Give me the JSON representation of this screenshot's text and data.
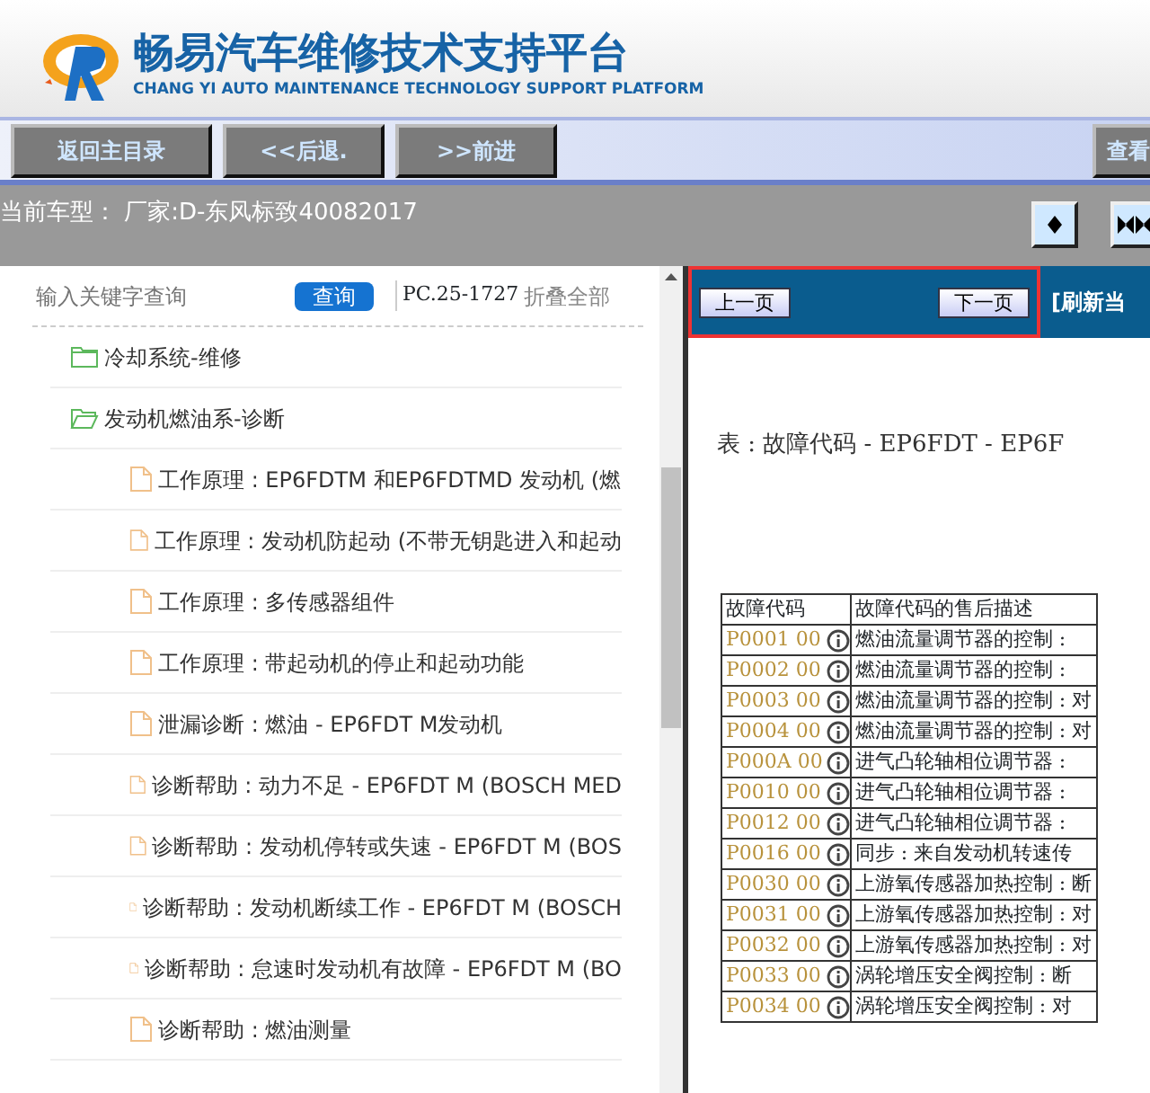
{
  "header": {
    "title": "畅易汽车维修技术支持平台",
    "subtitle": "CHANG YI AUTO MAINTENANCE TECHNOLOGY SUPPORT PLATFORM"
  },
  "toolbar": {
    "buttons": [
      "返回主目录",
      "<<后退.",
      ">>前进"
    ],
    "right_button": "查看"
  },
  "vehicle_bar": {
    "text": "当前车型：  厂家:D-东风标致40082017"
  },
  "sidebar": {
    "search": {
      "placeholder": "输入关键字查询"
    },
    "search_button": "查询",
    "code": "PC.25-1727",
    "collapse_all": "折叠全部",
    "tree": [
      {
        "label": "冷却系统-维修",
        "expanded": false
      },
      {
        "label": "发动机燃油系-诊断",
        "expanded": true,
        "children": [
          {
            "label": "工作原理 : EP6FDTM 和EP6FDTMD 发动机 (燃"
          },
          {
            "label": "工作原理 : 发动机防起动 (不带无钥匙进入和起动"
          },
          {
            "label": "工作原理 : 多传感器组件"
          },
          {
            "label": "工作原理 : 带起动机的停止和起动功能"
          },
          {
            "label": "泄漏诊断 : 燃油 - EP6FDT M发动机"
          },
          {
            "label": "诊断帮助 : 动力不足 - EP6FDT M (BOSCH MED"
          },
          {
            "label": "诊断帮助 : 发动机停转或失速 - EP6FDT M (BOS"
          },
          {
            "label": "诊断帮助 : 发动机断续工作 - EP6FDT M (BOSCH"
          },
          {
            "label": "诊断帮助 : 怠速时发动机有故障 - EP6FDT M (BO"
          },
          {
            "label": "诊断帮助 : 燃油测量"
          }
        ]
      }
    ]
  },
  "document": {
    "prev_button": "上一页",
    "next_button": "下一页",
    "refresh": "[刷新当",
    "heading": "表 : 故障代码 - EP6FDT - EP6F",
    "table": {
      "columns": [
        "故障代码",
        "故障代码的售后描述"
      ],
      "rows": [
        [
          "P0001  00",
          "燃油流量调节器的控制 :"
        ],
        [
          "P0002  00",
          "燃油流量调节器的控制 :"
        ],
        [
          "P0003  00",
          "燃油流量调节器的控制 : 对"
        ],
        [
          "P0004  00",
          "燃油流量调节器的控制 : 对"
        ],
        [
          "P000A  00",
          "进气凸轮轴相位调节器 :"
        ],
        [
          "P0010  00",
          "进气凸轮轴相位调节器 :"
        ],
        [
          "P0012  00",
          "进气凸轮轴相位调节器 :"
        ],
        [
          "P0016  00",
          "同步 : 来自发动机转速传"
        ],
        [
          "P0030  00",
          "上游氧传感器加热控制 : 断"
        ],
        [
          "P0031  00",
          "上游氧传感器加热控制 : 对"
        ],
        [
          "P0032  00",
          "上游氧传感器加热控制 : 对"
        ],
        [
          "P0033  00",
          "涡轮增压安全阀控制 : 断"
        ],
        [
          "P0034  00",
          "涡轮增压安全阀控制 : 对"
        ]
      ]
    }
  }
}
